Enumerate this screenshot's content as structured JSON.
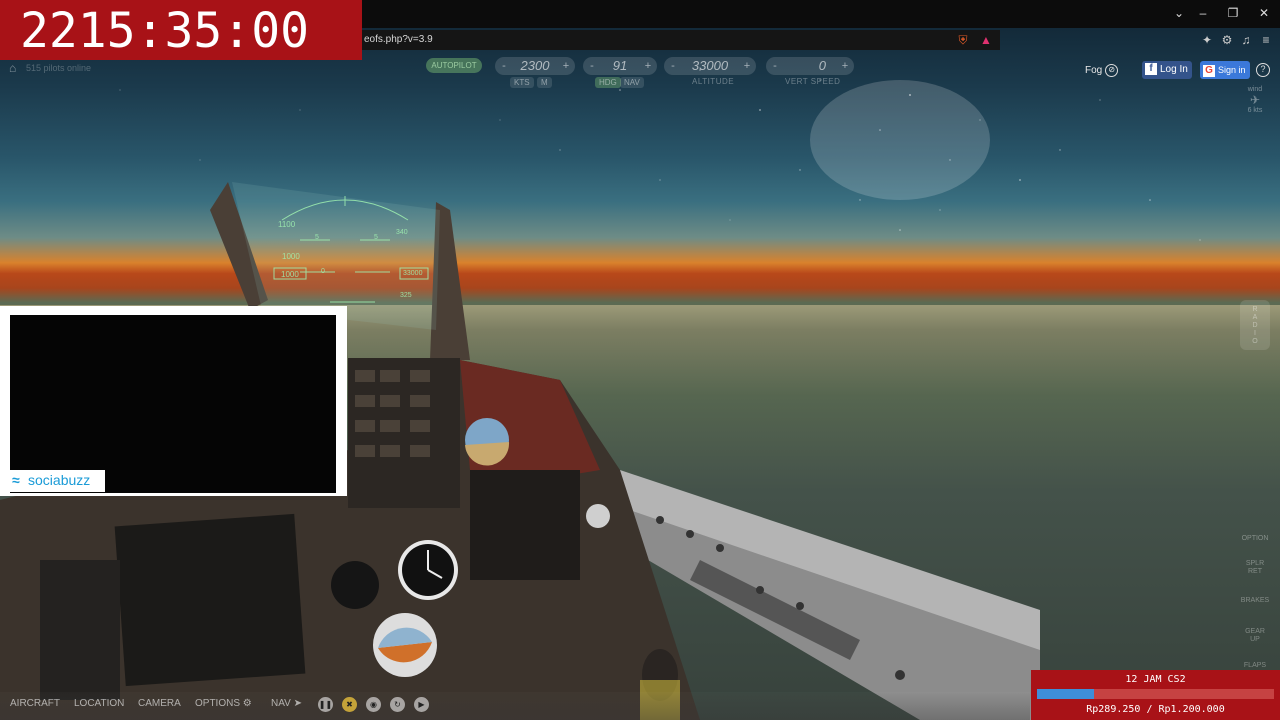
{
  "timer": "2215:35:00",
  "browser": {
    "url": "eofs.php?v=3.9",
    "window_controls": [
      "chevron-down-icon",
      "minimize-icon",
      "restore-icon",
      "close-icon"
    ]
  },
  "sim_header": {
    "pilots_online": "515 pilots online",
    "autopilot_label": "AUTOPILOT",
    "speed": {
      "value": "2300",
      "tags": [
        "KTS",
        "M"
      ],
      "minus": "-",
      "plus": "+"
    },
    "heading": {
      "value": "91",
      "tags": [
        "HDG",
        "NAV"
      ],
      "minus": "-",
      "plus": "+"
    },
    "altitude": {
      "value": "33000",
      "label": "ALTITUDE",
      "minus": "-",
      "plus": "+"
    },
    "vert_speed": {
      "value": "0",
      "label": "VERT SPEED",
      "minus": "-",
      "plus": "+"
    },
    "fog_label": "Fog",
    "facebook_login": "Log In",
    "google_signin": "Sign in",
    "help": "?"
  },
  "wind": {
    "label": "wind",
    "speed": "6 kts"
  },
  "side_buttons": {
    "radio": [
      "R",
      "A",
      "D",
      "I",
      "O"
    ],
    "option": "OPTION",
    "spoiler": [
      "SPLR",
      "RET"
    ],
    "brakes": "BRAKES",
    "gear": [
      "GEAR",
      "UP"
    ],
    "flaps": "FLAPS"
  },
  "bottom_menu": {
    "aircraft": "AIRCRAFT",
    "location": "LOCATION",
    "camera": "CAMERA",
    "options": "OPTIONS",
    "nav": "NAV"
  },
  "hud": {
    "speed_scale": [
      "1100",
      "1000"
    ],
    "alt_scale": [
      "340",
      "330",
      "325"
    ],
    "alt_box": "33000",
    "speed_box": "1000",
    "pitch": [
      "5",
      "0",
      "5"
    ]
  },
  "webcam": {
    "brand_parts": [
      "socia",
      "buzz"
    ]
  },
  "donation_goal": {
    "title": "12 JAM CS2",
    "amount": "Rp289.250 / Rp1.200.000",
    "progress_fraction": 0.241
  },
  "colors": {
    "overlay_red": "#a81217",
    "goal_blue": "#3e8ed8",
    "hud_green": "#9ff0b0"
  }
}
